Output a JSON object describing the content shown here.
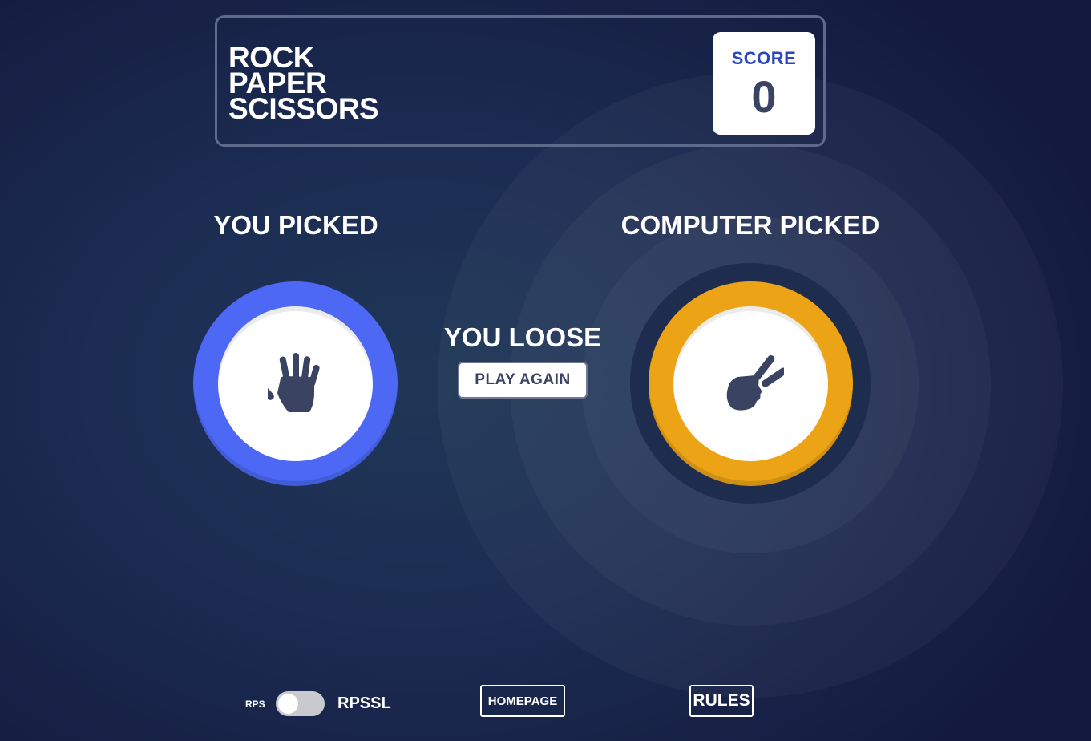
{
  "header": {
    "title_lines": [
      "ROCK",
      "PAPER",
      "SCISSORS"
    ],
    "score_label": "SCORE",
    "score_value": "0"
  },
  "player": {
    "heading": "YOU PICKED",
    "choice_icon": "paper-hand-icon",
    "ring_color": "#4c68f5"
  },
  "computer": {
    "heading": "COMPUTER PICKED",
    "choice_icon": "scissors-hand-icon",
    "ring_color": "#eca316"
  },
  "result": {
    "text": "YOU LOOSE",
    "play_again_label": "PLAY AGAIN"
  },
  "footer": {
    "mode_left_label": "RPS",
    "mode_right_label": "RPSSL",
    "mode_toggle_on": false,
    "homepage_label": "HOMEPAGE",
    "rules_label": "RULES"
  },
  "colors": {
    "background": "#1c2c52",
    "header_border": "#5e6a8c",
    "score_label": "#2a46c0",
    "score_value": "#3b4363",
    "icon": "#3b4363"
  }
}
